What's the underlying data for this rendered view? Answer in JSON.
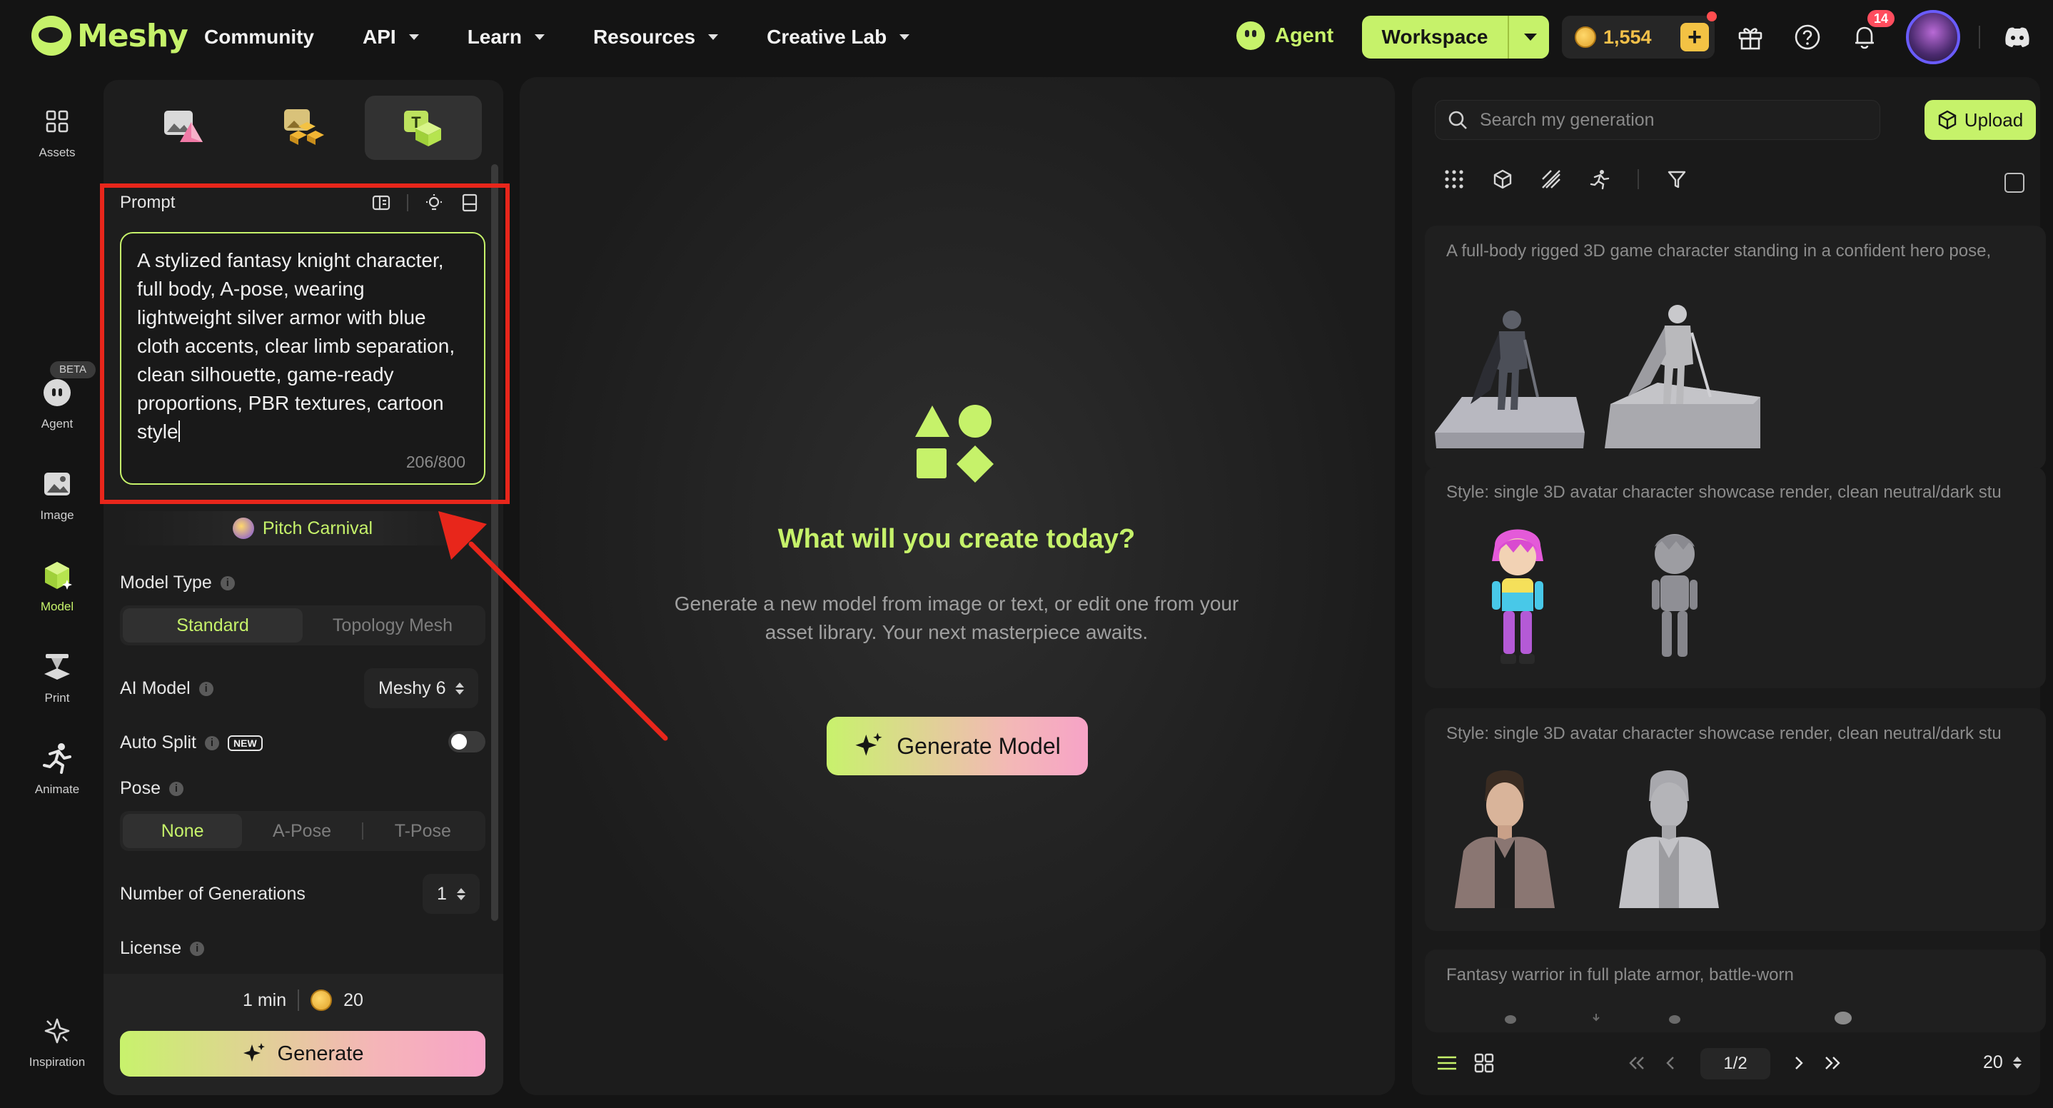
{
  "brand": {
    "name": "Meshy"
  },
  "nav": {
    "items": [
      {
        "label": "Community",
        "has_caret": false
      },
      {
        "label": "API",
        "has_caret": true
      },
      {
        "label": "Learn",
        "has_caret": true
      },
      {
        "label": "Resources",
        "has_caret": true
      },
      {
        "label": "Creative Lab",
        "has_caret": true
      }
    ],
    "agent_label": "Agent",
    "workspace_label": "Workspace",
    "credits": "1,554",
    "notification_count": "14"
  },
  "rail": {
    "items": [
      {
        "label": "Assets",
        "icon": "grid-icon"
      },
      {
        "label": "Agent",
        "icon": "agent-icon",
        "badge": "BETA"
      },
      {
        "label": "Image",
        "icon": "image-icon"
      },
      {
        "label": "Model",
        "icon": "cube-icon",
        "active": true
      },
      {
        "label": "Print",
        "icon": "printer-icon"
      },
      {
        "label": "Animate",
        "icon": "running-icon"
      }
    ],
    "bottom_label": "Inspiration"
  },
  "left_panel": {
    "prompt_label": "Prompt",
    "prompt_text": "A stylized fantasy knight character,\nfull body, A-pose, wearing\nlightweight silver armor with blue\ncloth accents, clear limb separation,\nclean silhouette, game-ready\nproportions, PBR textures, cartoon\nstyle",
    "prompt_count": "206/800",
    "pitch_label": "Pitch Carnival",
    "model_type_label": "Model Type",
    "model_type_options": [
      "Standard",
      "Topology Mesh"
    ],
    "ai_model_label": "AI Model",
    "ai_model_value": "Meshy 6",
    "auto_split_label": "Auto Split",
    "new_tag": "NEW",
    "pose_label": "Pose",
    "pose_options": [
      "None",
      "A-Pose",
      "T-Pose"
    ],
    "generations_label": "Number of Generations",
    "generations_value": "1",
    "license_label": "License",
    "time_label": "1 min",
    "cost_value": "20",
    "generate_label": "Generate"
  },
  "center": {
    "title": "What will you create today?",
    "subtitle_line1": "Generate a new model from image or text, or edit one from your",
    "subtitle_line2": "asset library. Your next masterpiece awaits.",
    "button_label": "Generate Model"
  },
  "right_panel": {
    "search_placeholder": "Search my generation",
    "upload_label": "Upload",
    "cards": [
      {
        "title": "A full-body rigged 3D game character standing in a confident hero pose,"
      },
      {
        "title": "Style: single 3D avatar character showcase render, clean neutral/dark stu"
      },
      {
        "title": "Style: single 3D avatar character showcase render, clean neutral/dark stu"
      },
      {
        "title": "Fantasy warrior in full plate armor, battle-worn"
      }
    ],
    "page_value": "1/2",
    "page_size": "20"
  },
  "colors": {
    "accent": "#c6f26a",
    "annotation": "#e8261b",
    "background": "#141414"
  }
}
